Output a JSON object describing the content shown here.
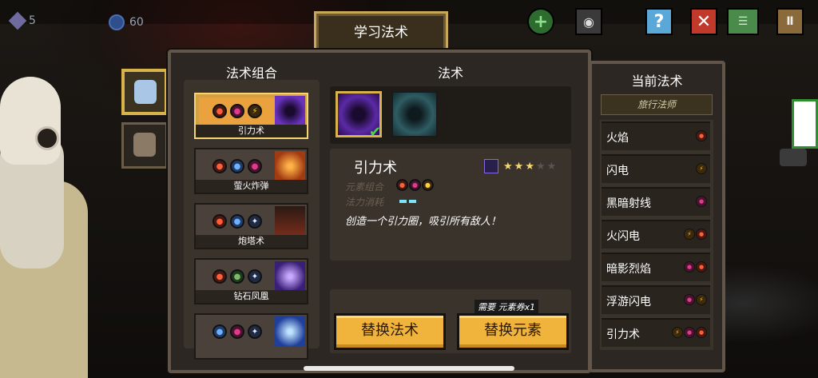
{
  "hud": {
    "gems": "5",
    "coins": "60",
    "help_icon": "?"
  },
  "learn_tab": "学习法术",
  "columns": {
    "combos": "法术组合",
    "spells": "法术"
  },
  "combos": [
    {
      "name": "引力术",
      "elements": [
        "fire",
        "dark",
        "bolt"
      ],
      "selected": true
    },
    {
      "name": "萤火炸弹",
      "elements": [
        "fire",
        "ice",
        "dark"
      ],
      "selected": false
    },
    {
      "name": "炮塔术",
      "elements": [
        "fire",
        "ice",
        "cross"
      ],
      "selected": false
    },
    {
      "name": "钻石凤凰",
      "elements": [
        "fire",
        "earth",
        "cross"
      ],
      "selected": false
    },
    {
      "name": "",
      "elements": [
        "ice",
        "dark",
        "cross"
      ],
      "selected": false
    }
  ],
  "spell_detail": {
    "title": "引力术",
    "stars": 3,
    "max_stars": 5,
    "element_label": "元素组合",
    "mana_label": "法力消耗",
    "description": "创造一个引力圈，吸引所有敌人！"
  },
  "buttons": {
    "replace_spell": "替换法术",
    "replace_element": "替换元素",
    "need_note": "需要 元素券x1"
  },
  "current": {
    "title": "当前法术",
    "subtitle": "旅行法师",
    "items": [
      {
        "name": "火焰",
        "elements": [
          "fire"
        ]
      },
      {
        "name": "闪电",
        "elements": [
          "bolt"
        ]
      },
      {
        "name": "黑暗射线",
        "elements": [
          "dark"
        ]
      },
      {
        "name": "火闪电",
        "elements": [
          "bolt",
          "fire"
        ]
      },
      {
        "name": "暗影烈焰",
        "elements": [
          "dark",
          "fire"
        ]
      },
      {
        "name": "浮游闪电",
        "elements": [
          "dark",
          "bolt"
        ]
      },
      {
        "name": "引力术",
        "elements": [
          "bolt",
          "dark",
          "fire"
        ]
      }
    ]
  },
  "colors": {
    "accent_gold": "#f0b33b",
    "panel": "#2c2722",
    "border": "#615649"
  }
}
